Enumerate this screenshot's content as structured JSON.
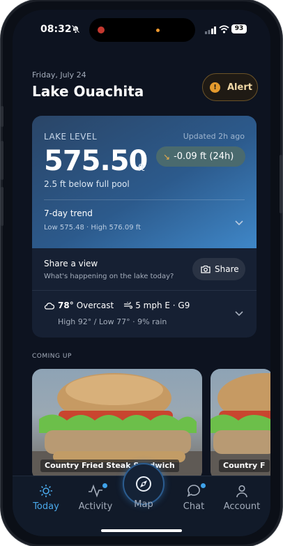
{
  "status_bar": {
    "time": "08:32",
    "battery": "93"
  },
  "header": {
    "date": "Friday, July 24",
    "lake_name": "Lake Ouachita",
    "alert_label": "Alert",
    "alert_icon": "!"
  },
  "lake_level": {
    "title": "LAKE LEVEL",
    "updated": "Updated 2h ago",
    "value": "575.50",
    "unit": "ft",
    "change": "-0.09 ft (24h)",
    "below_pool": "2.5 ft below full pool",
    "trend_title": "7-day trend",
    "trend_range": "Low 575.48 · High 576.09 ft"
  },
  "share": {
    "title": "Share a view",
    "subtitle": "What's happening on the lake today?",
    "button": "Share"
  },
  "weather": {
    "temp": "78°",
    "condition": "Overcast",
    "wind": "5 mph E · G9",
    "detail": "High 92° / Low 77° · 9% rain"
  },
  "coming_up": {
    "title": "COMING UP",
    "events": [
      {
        "label": "Country Fried Steak Sandwich"
      },
      {
        "label": "Country F"
      }
    ]
  },
  "tabs": [
    {
      "label": "Today",
      "icon": "sun-icon",
      "active": true
    },
    {
      "label": "Activity",
      "icon": "activity-icon",
      "badge": true
    },
    {
      "label": "Map",
      "icon": "compass-icon"
    },
    {
      "label": "Chat",
      "icon": "chat-icon",
      "badge": true
    },
    {
      "label": "Account",
      "icon": "user-icon"
    }
  ],
  "colors": {
    "accent": "#4aa8ea",
    "alert": "#e49a2d",
    "card_gradient_end": "#3f87c8",
    "background": "#0d1320"
  }
}
